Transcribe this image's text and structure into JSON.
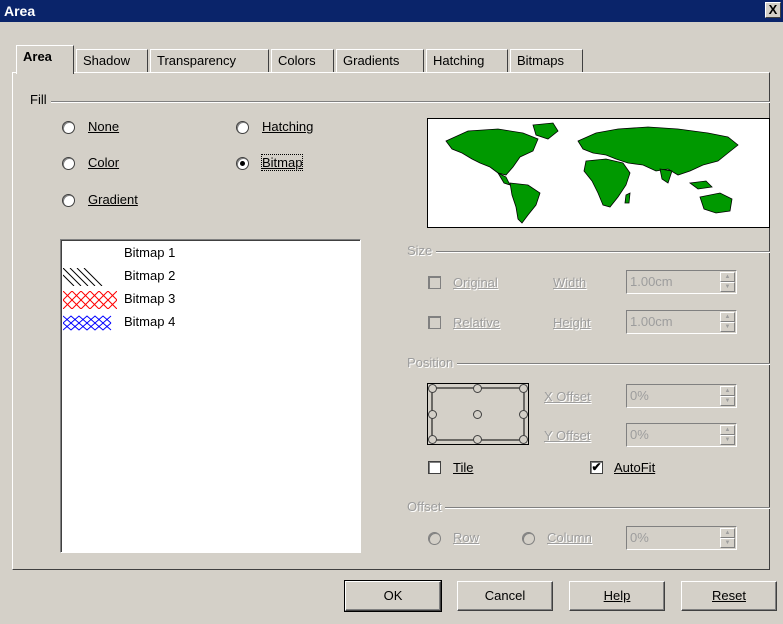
{
  "window": {
    "title": "Area",
    "close_label": "X"
  },
  "tabs": [
    "Area",
    "Shadow",
    "Transparency",
    "Colors",
    "Gradients",
    "Hatching",
    "Bitmaps"
  ],
  "fill": {
    "group_label": "Fill",
    "options": {
      "none": "None",
      "color": "Color",
      "gradient": "Gradient",
      "hatching": "Hatching",
      "bitmap": "Bitmap"
    },
    "selected": "Bitmap"
  },
  "bitmap_list": [
    "Bitmap 1",
    "Bitmap 2",
    "Bitmap 3",
    "Bitmap 4"
  ],
  "size": {
    "group_label": "Size",
    "original_label": "Original",
    "relative_label": "Relative",
    "width_label": "Width",
    "height_label": "Height",
    "width_value": "1.00cm",
    "height_value": "1.00cm"
  },
  "position": {
    "group_label": "Position",
    "x_offset_label": "X Offset",
    "y_offset_label": "Y Offset",
    "x_offset_value": "0%",
    "y_offset_value": "0%",
    "tile_label": "Tile",
    "autofit_label": "AutoFit",
    "tile_checked": false,
    "autofit_checked": true
  },
  "offset": {
    "group_label": "Offset",
    "row_label": "Row",
    "column_label": "Column",
    "value": "0%"
  },
  "buttons": {
    "ok": "OK",
    "cancel": "Cancel",
    "help": "Help",
    "reset": "Reset"
  },
  "colors": {
    "titlebar": "#0a246a",
    "face": "#d4d0c8",
    "map_green": "#009900"
  },
  "icons": {
    "check": "✔",
    "spin_up": "▲",
    "spin_down": "▼"
  }
}
